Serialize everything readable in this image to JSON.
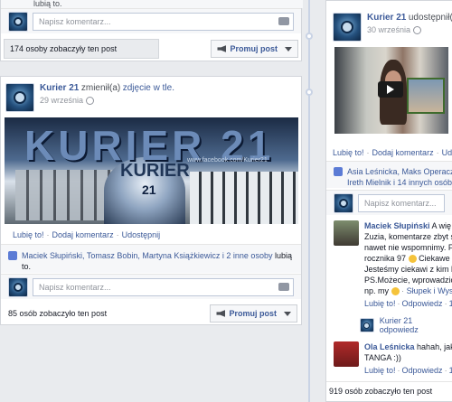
{
  "colors": {
    "link": "#3b5998",
    "background": "#e9ebee"
  },
  "top_post": {
    "comment_placeholder": "Napisz komentarz...",
    "likes_fragment": "lubią to.",
    "seen_text": "174 osoby zobaczyły ten post",
    "promote_label": "Promuj post"
  },
  "left_post": {
    "author": "Kurier 21",
    "action_prefix": "zmienił(a)",
    "action_link": "zdjęcie w tle.",
    "date": "29 września",
    "banner_title": "KURIER 21",
    "banner_small": "KURIER",
    "banner_number": "21",
    "banner_url": "www.facebook.com/Kurier21",
    "actions": [
      "Lubię to!",
      "Dodaj komentarz",
      "Udostępnij"
    ],
    "likes_line1": "Maciek Słupiński, Tomasz Bobin, Martyna Książkiewicz i 2 inne osoby",
    "likes_suffix": "lubią",
    "likes_line2": "to.",
    "comment_placeholder": "Napisz komentarz...",
    "seen_text": "85 osób zobaczyło ten post",
    "promote_label": "Promuj post"
  },
  "right_post": {
    "author": "Kurier 21",
    "action": "udostępnił(a)",
    "action_tail": "fil",
    "date": "30 września",
    "actions": [
      "Lubię to!",
      "Dodaj komentarz",
      "Udo"
    ],
    "likes_line1": "Asia Leśnicka, Maks Operacz,",
    "likes_line2": "Ireth Mielnik i 14 innych osób",
    "comment_placeholder": "Napisz komentarz...",
    "comment1": {
      "author": "Maciek Słupiński",
      "lines": [
        "A wię",
        "Zuzia, komentarze zbyt sz",
        "nawet nie wspomnimy. Fil",
        "rocznika 97",
        "Ciekawe n",
        "Jesteśmy ciekawi z kim bę",
        "PS.Możecie, wprowadzić ",
        "np. my"
      ],
      "tail_link": "Słupek i Wys",
      "meta": [
        "Lubię to!",
        "Odpowiedz",
        "1"
      ]
    },
    "reply": {
      "author_text": "Kurier 21 odpowiedz"
    },
    "comment2": {
      "author": "Ola Leśnicka",
      "text": "hahah, jak",
      "line2": "TANGA :))",
      "meta": [
        "Lubię to!",
        "Odpowiedz",
        "1"
      ]
    },
    "seen_text": "919 osób zobaczyło ten post"
  }
}
